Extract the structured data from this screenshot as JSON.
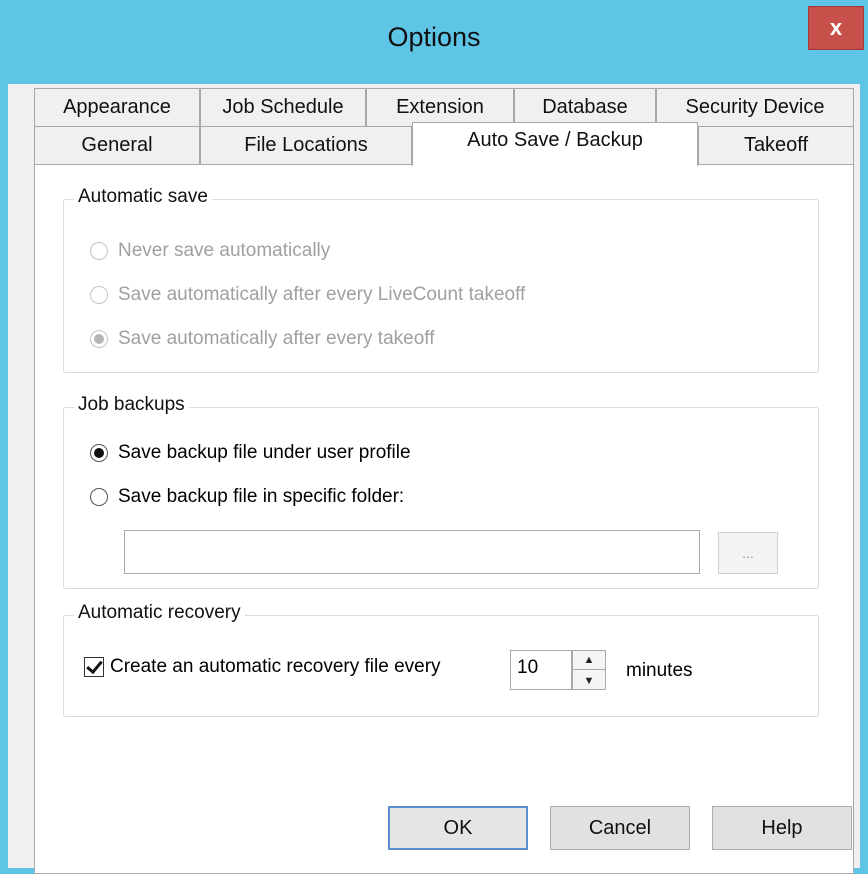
{
  "window": {
    "title": "Options",
    "close_label": "x"
  },
  "tabs": {
    "row1": [
      "Appearance",
      "Job Schedule",
      "Extension",
      "Database",
      "Security Device"
    ],
    "row2": [
      "General",
      "File Locations",
      "Auto Save / Backup",
      "Takeoff"
    ],
    "active": "Auto Save / Backup"
  },
  "automatic_save": {
    "label": "Automatic save",
    "options": [
      "Never save automatically",
      "Save automatically after every LiveCount takeoff",
      "Save automatically after every takeoff"
    ],
    "selected_index": 2,
    "disabled": true
  },
  "job_backups": {
    "label": "Job backups",
    "options": [
      "Save backup file under user profile",
      "Save backup file in specific folder:"
    ],
    "selected_index": 0,
    "folder_value": "",
    "browse_label": "..."
  },
  "automatic_recovery": {
    "label": "Automatic recovery",
    "checkbox_label": "Create an automatic recovery file every",
    "checked": true,
    "interval_value": "10",
    "units_label": "minutes"
  },
  "buttons": {
    "ok": "OK",
    "cancel": "Cancel",
    "help": "Help"
  }
}
